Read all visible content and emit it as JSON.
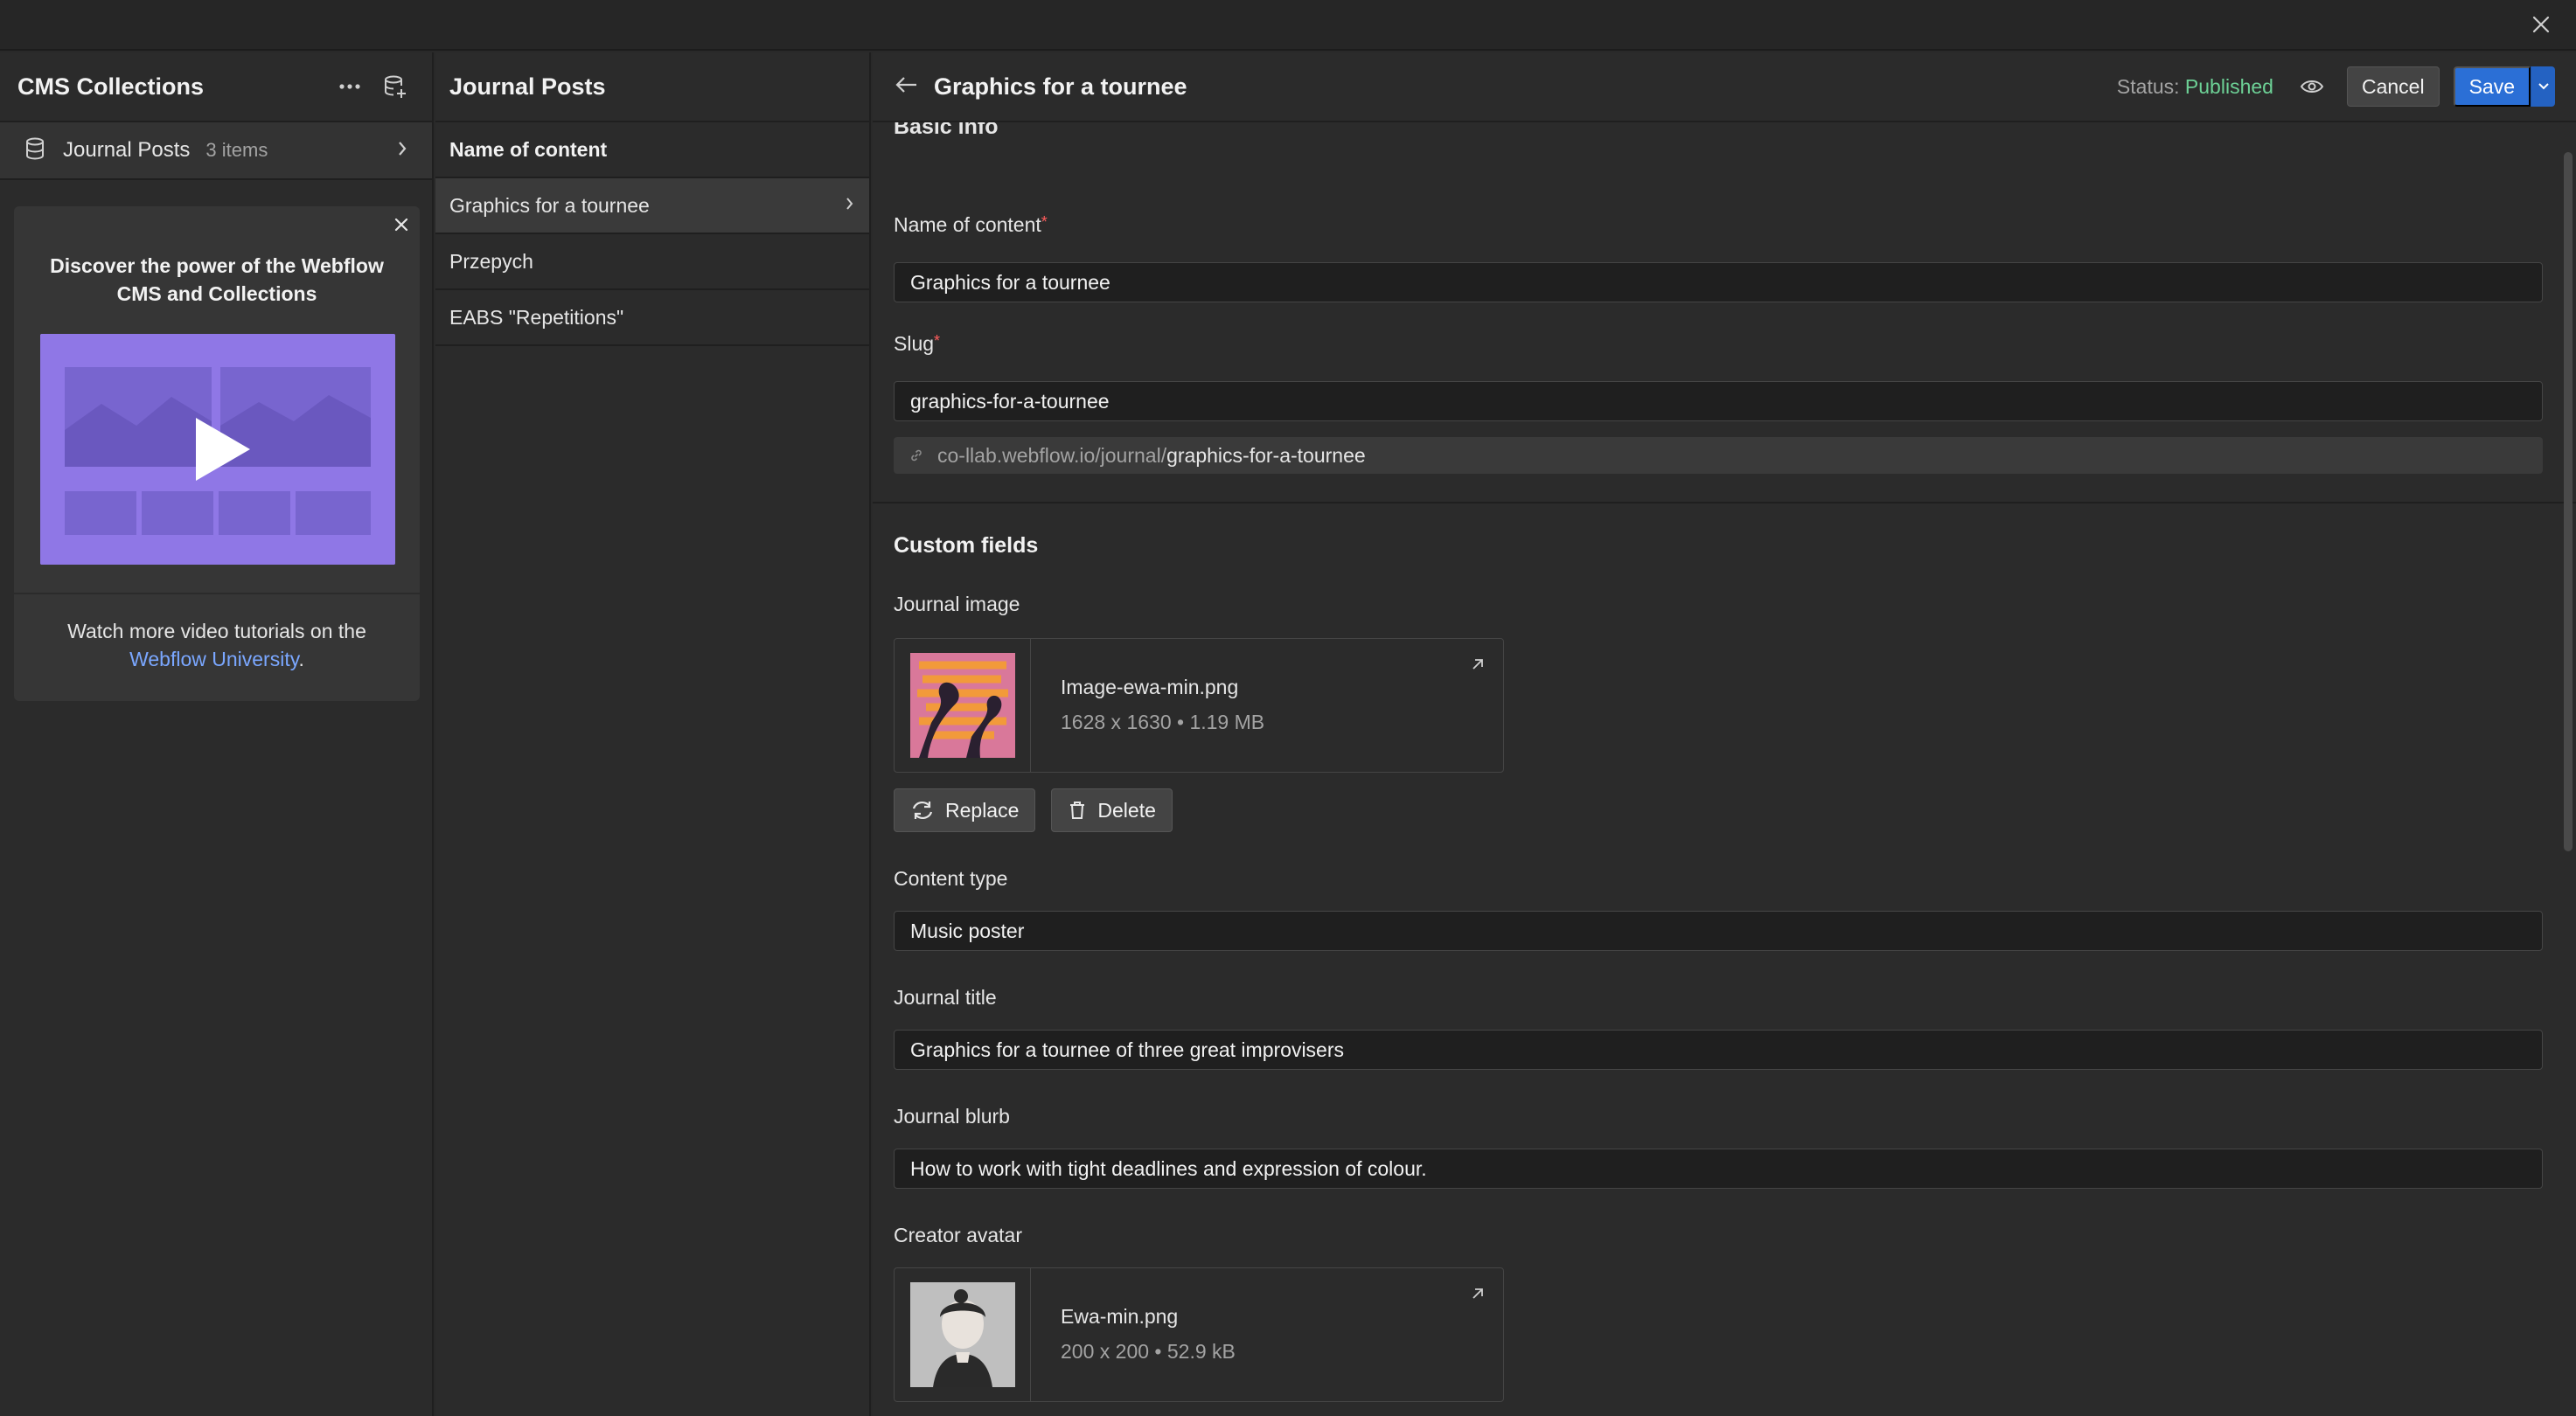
{
  "left_panel": {
    "title": "CMS Collections",
    "collection": {
      "label": "Journal Posts",
      "count": "3 items"
    },
    "promo": {
      "title": "Discover the power of the Webflow CMS and Collections",
      "text_prefix": "Watch more video tutorials on the",
      "link": "Webflow University",
      "text_suffix": "."
    }
  },
  "middle_panel": {
    "title": "Journal Posts",
    "column_header": "Name of content",
    "items": [
      {
        "label": "Graphics for a tournee"
      },
      {
        "label": "Przepych"
      },
      {
        "label": "EABS \"Repetitions\""
      }
    ]
  },
  "editor": {
    "title": "Graphics for a tournee",
    "status_label": "Status:",
    "status_value": "Published",
    "cancel_label": "Cancel",
    "save_label": "Save",
    "basic_info_heading": "Basic info",
    "name_label": "Name of content",
    "name_value": "Graphics for a tournee",
    "slug_label": "Slug",
    "slug_value": "graphics-for-a-tournee",
    "url_base": "co-llab.webflow.io/journal/",
    "url_slug": "graphics-for-a-tournee",
    "custom_fields_heading": "Custom fields",
    "journal_image": {
      "label": "Journal image",
      "filename": "Image-ewa-min.png",
      "meta": "1628 x 1630 • 1.19 MB"
    },
    "replace_label": "Replace",
    "delete_label": "Delete",
    "content_type_label": "Content type",
    "content_type_value": "Music poster",
    "journal_title_label": "Journal title",
    "journal_title_value": "Graphics for a tournee of three great improvisers",
    "journal_blurb_label": "Journal blurb",
    "journal_blurb_value": "How to work with tight deadlines and expression of colour.",
    "creator_avatar": {
      "label": "Creator avatar",
      "filename": "Ewa-min.png",
      "meta": "200 x 200 • 52.9 kB"
    }
  },
  "colors": {
    "accent": "#2b6fd6",
    "published": "#6dd196",
    "required": "#ff5c5c",
    "link": "#7aa7ff"
  }
}
